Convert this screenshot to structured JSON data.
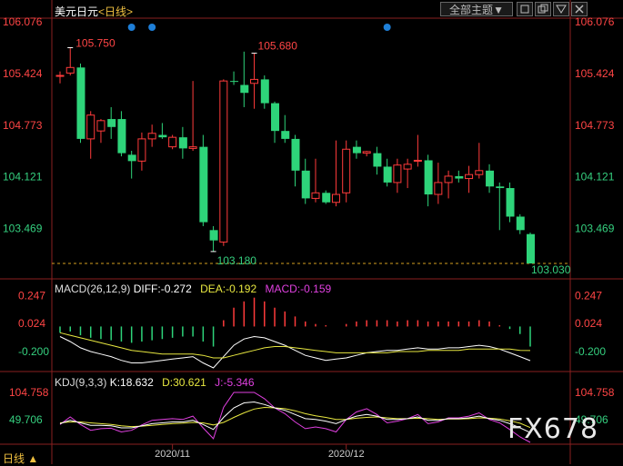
{
  "header": {
    "symbol": "美元日元",
    "period_open": "<",
    "period": "日线",
    "period_close": ">",
    "theme_button": "全部主题",
    "theme_arrow": "▼",
    "tool_icons": [
      "square-icon",
      "restore-icon",
      "maximize-icon",
      "close-icon"
    ]
  },
  "footer": {
    "period": "日线",
    "arrow": "▲",
    "watermark": "FX678"
  },
  "colors": {
    "up": "#ff3b3b",
    "down": "#2ed47a",
    "axis_up": "#ff4545",
    "axis_down": "#35d07f",
    "dif": "#ffffff",
    "dea": "#e8e840",
    "macd_label": "#e040e0",
    "k": "#ffffff",
    "d": "#e8e840",
    "j": "#e040e0"
  },
  "chart_data": [
    {
      "type": "candlestick",
      "name": "price",
      "ylim": [
        103.03,
        106.076
      ],
      "y_ticks": [
        "106.076",
        "105.424",
        "104.773",
        "104.121",
        "103.469"
      ],
      "x_ticks": [
        "2020/11",
        "2020/12"
      ],
      "annotations": {
        "high": "105.750",
        "high2": "105.680",
        "low": "103.180",
        "last": "103.030"
      },
      "event_markers": [
        7,
        9,
        32
      ],
      "candles": [
        {
          "o": 105.4,
          "h": 105.45,
          "l": 105.3,
          "c": 105.4
        },
        {
          "o": 105.43,
          "h": 105.75,
          "l": 105.4,
          "c": 105.5
        },
        {
          "o": 105.5,
          "h": 105.55,
          "l": 104.55,
          "c": 104.6
        },
        {
          "o": 104.6,
          "h": 104.95,
          "l": 104.35,
          "c": 104.9
        },
        {
          "o": 104.7,
          "h": 104.85,
          "l": 104.55,
          "c": 104.83
        },
        {
          "o": 104.85,
          "h": 105.0,
          "l": 104.6,
          "c": 104.75
        },
        {
          "o": 104.85,
          "h": 104.95,
          "l": 104.38,
          "c": 104.42
        },
        {
          "o": 104.4,
          "h": 104.45,
          "l": 104.1,
          "c": 104.32
        },
        {
          "o": 104.32,
          "h": 104.68,
          "l": 104.2,
          "c": 104.6
        },
        {
          "o": 104.6,
          "h": 104.78,
          "l": 104.5,
          "c": 104.67
        },
        {
          "o": 104.65,
          "h": 104.8,
          "l": 104.6,
          "c": 104.62
        },
        {
          "o": 104.5,
          "h": 104.65,
          "l": 104.47,
          "c": 104.62
        },
        {
          "o": 104.62,
          "h": 104.75,
          "l": 104.35,
          "c": 104.48
        },
        {
          "o": 104.48,
          "h": 105.33,
          "l": 104.45,
          "c": 104.5
        },
        {
          "o": 104.5,
          "h": 104.65,
          "l": 103.5,
          "c": 103.55
        },
        {
          "o": 103.45,
          "h": 103.5,
          "l": 103.18,
          "c": 103.32
        },
        {
          "o": 103.3,
          "h": 105.35,
          "l": 103.25,
          "c": 105.33
        },
        {
          "o": 105.33,
          "h": 105.45,
          "l": 105.28,
          "c": 105.32
        },
        {
          "o": 105.28,
          "h": 105.7,
          "l": 105.0,
          "c": 105.18
        },
        {
          "o": 105.3,
          "h": 105.68,
          "l": 104.98,
          "c": 105.35
        },
        {
          "o": 105.35,
          "h": 105.4,
          "l": 104.98,
          "c": 105.05
        },
        {
          "o": 105.05,
          "h": 105.07,
          "l": 104.55,
          "c": 104.7
        },
        {
          "o": 104.7,
          "h": 104.9,
          "l": 104.55,
          "c": 104.6
        },
        {
          "o": 104.6,
          "h": 104.65,
          "l": 104.0,
          "c": 104.2
        },
        {
          "o": 104.2,
          "h": 104.35,
          "l": 103.78,
          "c": 103.85
        },
        {
          "o": 103.85,
          "h": 104.35,
          "l": 103.8,
          "c": 103.92
        },
        {
          "o": 103.92,
          "h": 103.95,
          "l": 103.78,
          "c": 103.8
        },
        {
          "o": 103.8,
          "h": 104.58,
          "l": 103.75,
          "c": 103.9
        },
        {
          "o": 103.92,
          "h": 104.58,
          "l": 103.8,
          "c": 104.47
        },
        {
          "o": 104.5,
          "h": 104.58,
          "l": 104.35,
          "c": 104.42
        },
        {
          "o": 104.42,
          "h": 104.45,
          "l": 104.38,
          "c": 104.44
        },
        {
          "o": 104.42,
          "h": 104.5,
          "l": 104.15,
          "c": 104.25
        },
        {
          "o": 104.25,
          "h": 104.35,
          "l": 104.0,
          "c": 104.05
        },
        {
          "o": 104.05,
          "h": 104.35,
          "l": 103.92,
          "c": 104.27
        },
        {
          "o": 104.22,
          "h": 104.35,
          "l": 103.98,
          "c": 104.28
        },
        {
          "o": 104.32,
          "h": 104.65,
          "l": 104.25,
          "c": 104.33
        },
        {
          "o": 104.33,
          "h": 104.4,
          "l": 103.75,
          "c": 103.9
        },
        {
          "o": 103.9,
          "h": 104.3,
          "l": 103.78,
          "c": 104.05
        },
        {
          "o": 104.05,
          "h": 104.2,
          "l": 103.85,
          "c": 104.13
        },
        {
          "o": 104.13,
          "h": 104.2,
          "l": 104.05,
          "c": 104.1
        },
        {
          "o": 104.1,
          "h": 104.26,
          "l": 103.92,
          "c": 104.15
        },
        {
          "o": 104.15,
          "h": 104.55,
          "l": 104.1,
          "c": 104.2
        },
        {
          "o": 104.2,
          "h": 104.28,
          "l": 103.92,
          "c": 104.0
        },
        {
          "o": 104.0,
          "h": 104.05,
          "l": 103.45,
          "c": 103.98
        },
        {
          "o": 103.98,
          "h": 104.05,
          "l": 103.55,
          "c": 103.62
        },
        {
          "o": 103.62,
          "h": 103.65,
          "l": 103.4,
          "c": 103.45
        },
        {
          "o": 103.4,
          "h": 103.42,
          "l": 103.03,
          "c": 103.03
        }
      ]
    },
    {
      "type": "line+bar",
      "name": "macd",
      "label": "MACD(26,12,9)",
      "dif_label": "DIFF:-0.272",
      "dea_label": "DEA:-0.192",
      "macd_label": "MACD:-0.159",
      "ylim": [
        -0.33,
        0.3
      ],
      "y_ticks": [
        "0.247",
        "0.024",
        "-0.200"
      ],
      "hist": [
        -0.05,
        -0.04,
        -0.07,
        -0.09,
        -0.1,
        -0.11,
        -0.12,
        -0.13,
        -0.12,
        -0.11,
        -0.1,
        -0.09,
        -0.08,
        -0.08,
        -0.12,
        -0.16,
        0.05,
        0.15,
        0.2,
        0.23,
        0.2,
        0.15,
        0.12,
        0.08,
        0.04,
        0.02,
        0.01,
        0.0,
        0.02,
        0.04,
        0.05,
        0.05,
        0.05,
        0.04,
        0.05,
        0.05,
        0.04,
        0.04,
        0.04,
        0.04,
        0.04,
        0.05,
        0.04,
        0.01,
        -0.02,
        -0.06,
        -0.16
      ],
      "dif": [
        -0.08,
        -0.12,
        -0.17,
        -0.2,
        -0.22,
        -0.24,
        -0.27,
        -0.29,
        -0.29,
        -0.28,
        -0.27,
        -0.26,
        -0.25,
        -0.24,
        -0.29,
        -0.33,
        -0.24,
        -0.15,
        -0.1,
        -0.08,
        -0.09,
        -0.12,
        -0.15,
        -0.19,
        -0.23,
        -0.25,
        -0.27,
        -0.26,
        -0.25,
        -0.23,
        -0.21,
        -0.2,
        -0.19,
        -0.19,
        -0.18,
        -0.17,
        -0.18,
        -0.18,
        -0.17,
        -0.17,
        -0.16,
        -0.15,
        -0.16,
        -0.18,
        -0.21,
        -0.24,
        -0.272
      ],
      "dea": [
        -0.05,
        -0.07,
        -0.09,
        -0.11,
        -0.13,
        -0.15,
        -0.17,
        -0.19,
        -0.2,
        -0.21,
        -0.22,
        -0.22,
        -0.22,
        -0.22,
        -0.23,
        -0.25,
        -0.25,
        -0.23,
        -0.21,
        -0.19,
        -0.17,
        -0.16,
        -0.16,
        -0.17,
        -0.18,
        -0.19,
        -0.2,
        -0.21,
        -0.21,
        -0.21,
        -0.21,
        -0.21,
        -0.21,
        -0.2,
        -0.2,
        -0.2,
        -0.19,
        -0.19,
        -0.19,
        -0.19,
        -0.18,
        -0.18,
        -0.18,
        -0.18,
        -0.18,
        -0.19,
        -0.192
      ]
    },
    {
      "type": "line",
      "name": "kdj",
      "label": "KDJ(9,3,3)",
      "k_label": "K:18.632",
      "d_label": "D:30.621",
      "j_label": "J:-5.346",
      "ylim": [
        -5,
        115
      ],
      "y_ticks": [
        "104.758",
        "49.706"
      ],
      "k": [
        40,
        48,
        42,
        36,
        36,
        35,
        30,
        30,
        35,
        40,
        42,
        44,
        44,
        48,
        38,
        26,
        55,
        78,
        90,
        92,
        86,
        78,
        72,
        62,
        52,
        50,
        46,
        40,
        50,
        58,
        62,
        58,
        50,
        50,
        52,
        56,
        48,
        48,
        52,
        52,
        54,
        58,
        52,
        48,
        40,
        30,
        18.632
      ],
      "d": [
        42,
        44,
        44,
        42,
        40,
        38,
        35,
        33,
        34,
        36,
        38,
        40,
        41,
        43,
        42,
        37,
        43,
        55,
        66,
        75,
        79,
        78,
        76,
        71,
        64,
        59,
        55,
        50,
        50,
        53,
        55,
        56,
        54,
        52,
        52,
        53,
        52,
        50,
        51,
        51,
        52,
        54,
        53,
        51,
        47,
        41,
        30.621
      ],
      "j": [
        38,
        56,
        38,
        24,
        28,
        29,
        20,
        24,
        37,
        48,
        50,
        52,
        50,
        58,
        30,
        4,
        79,
        115,
        115,
        115,
        100,
        78,
        64,
        44,
        28,
        32,
        28,
        20,
        50,
        68,
        76,
        62,
        42,
        46,
        52,
        62,
        40,
        44,
        54,
        54,
        58,
        66,
        50,
        42,
        26,
        8,
        -5.346
      ]
    }
  ]
}
